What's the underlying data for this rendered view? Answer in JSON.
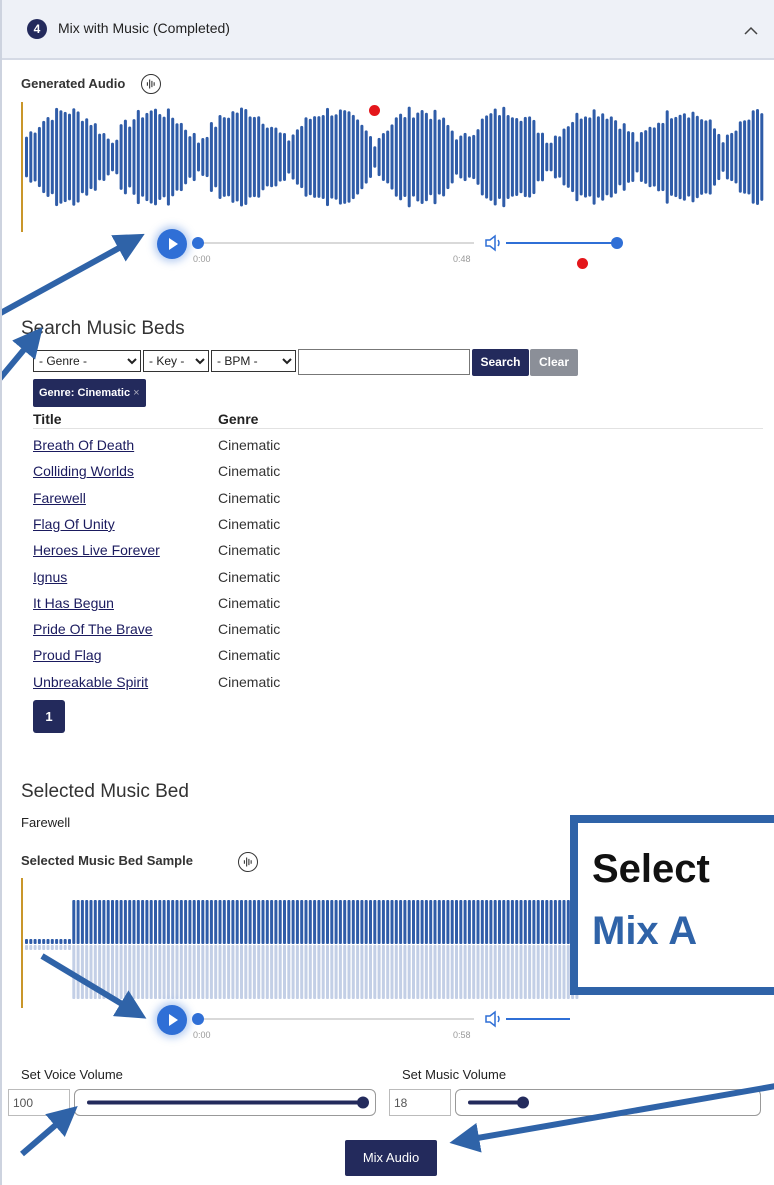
{
  "section": {
    "step_number": "4",
    "title": "Mix with Music (Completed)"
  },
  "generated_audio": {
    "label": "Generated Audio",
    "time_start": "0:00",
    "time_end": "0:48",
    "progress": 0.0,
    "volume": 1.0
  },
  "search": {
    "heading": "Search Music Beds",
    "genre_select": "- Genre -",
    "key_select": "- Key -",
    "bpm_select": "- BPM -",
    "query_value": "",
    "search_label": "Search",
    "clear_label": "Clear",
    "filter_chip": "Genre: Cinematic",
    "chip_close": "×"
  },
  "table": {
    "headers": [
      "Title",
      "Genre"
    ],
    "rows": [
      {
        "title": "Breath Of Death",
        "genre": "Cinematic"
      },
      {
        "title": "Colliding Worlds",
        "genre": "Cinematic"
      },
      {
        "title": "Farewell",
        "genre": "Cinematic"
      },
      {
        "title": "Flag Of Unity",
        "genre": "Cinematic"
      },
      {
        "title": "Heroes Live Forever",
        "genre": "Cinematic"
      },
      {
        "title": "Ignus",
        "genre": "Cinematic"
      },
      {
        "title": "It Has Begun",
        "genre": "Cinematic"
      },
      {
        "title": "Pride Of The Brave",
        "genre": "Cinematic"
      },
      {
        "title": "Proud Flag",
        "genre": "Cinematic"
      },
      {
        "title": "Unbreakable Spirit",
        "genre": "Cinematic"
      }
    ],
    "page": "1"
  },
  "selected": {
    "heading": "Selected Music Bed",
    "name": "Farewell",
    "sample_label": "Selected Music Bed Sample",
    "time_start": "0:00",
    "time_end": "0:58"
  },
  "volumes": {
    "voice_label": "Set Voice Volume",
    "voice_value": "100",
    "music_label": "Set Music Volume",
    "music_value": "18"
  },
  "mix_button": "Mix Audio",
  "overlay": {
    "line1": "Select",
    "line2": "Mix A"
  },
  "colors": {
    "navy": "#232a5c",
    "wave_blue": "#2f5ca8",
    "accent_blue": "#2f6fd6",
    "annotation_blue": "#2f63a8",
    "red_marker": "#e4161b"
  }
}
